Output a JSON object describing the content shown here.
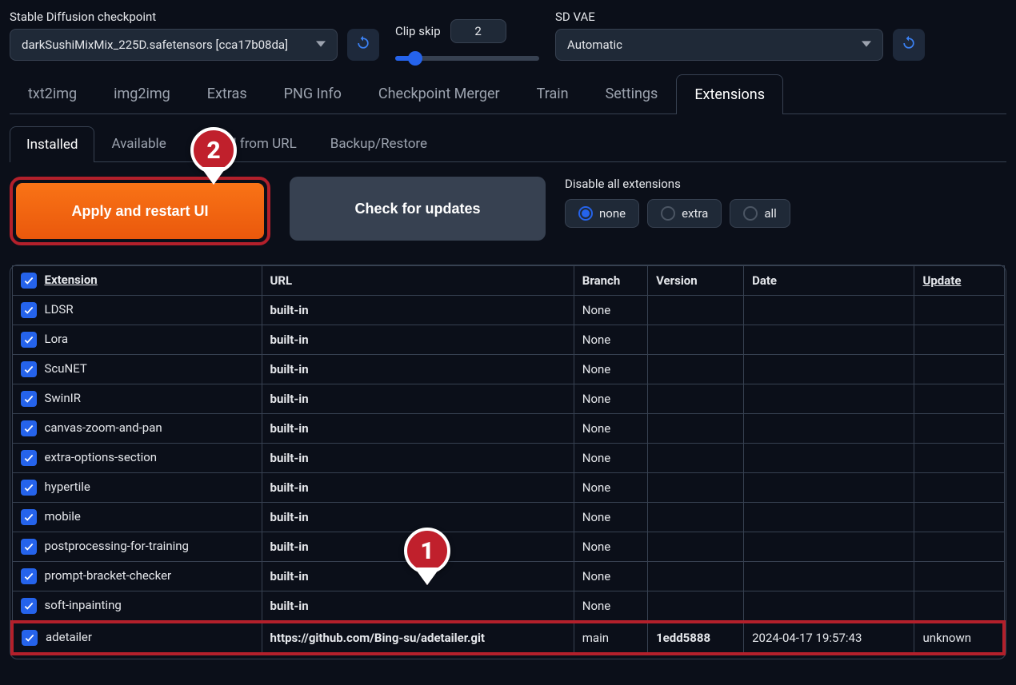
{
  "header": {
    "checkpoint_label": "Stable Diffusion checkpoint",
    "checkpoint_value": "darkSushiMixMix_225D.safetensors [cca17b08da]",
    "clip_skip_label": "Clip skip",
    "clip_skip_value": "2",
    "vae_label": "SD VAE",
    "vae_value": "Automatic"
  },
  "main_tabs": [
    "txt2img",
    "img2img",
    "Extras",
    "PNG Info",
    "Checkpoint Merger",
    "Train",
    "Settings",
    "Extensions"
  ],
  "main_tab_active": 7,
  "sub_tabs": [
    "Installed",
    "Available",
    "Install from URL",
    "Backup/Restore"
  ],
  "sub_tab_active": 0,
  "buttons": {
    "apply": "Apply and restart UI",
    "check": "Check for updates"
  },
  "disable": {
    "label": "Disable all extensions",
    "options": [
      "none",
      "extra",
      "all"
    ],
    "selected": 0
  },
  "table": {
    "headers": [
      "Extension",
      "URL",
      "Branch",
      "Version",
      "Date",
      "Update"
    ],
    "rows": [
      {
        "name": "LDSR",
        "url": "built-in",
        "branch": "None",
        "version": "",
        "date": "",
        "update": ""
      },
      {
        "name": "Lora",
        "url": "built-in",
        "branch": "None",
        "version": "",
        "date": "",
        "update": ""
      },
      {
        "name": "ScuNET",
        "url": "built-in",
        "branch": "None",
        "version": "",
        "date": "",
        "update": ""
      },
      {
        "name": "SwinIR",
        "url": "built-in",
        "branch": "None",
        "version": "",
        "date": "",
        "update": ""
      },
      {
        "name": "canvas-zoom-and-pan",
        "url": "built-in",
        "branch": "None",
        "version": "",
        "date": "",
        "update": ""
      },
      {
        "name": "extra-options-section",
        "url": "built-in",
        "branch": "None",
        "version": "",
        "date": "",
        "update": ""
      },
      {
        "name": "hypertile",
        "url": "built-in",
        "branch": "None",
        "version": "",
        "date": "",
        "update": ""
      },
      {
        "name": "mobile",
        "url": "built-in",
        "branch": "None",
        "version": "",
        "date": "",
        "update": ""
      },
      {
        "name": "postprocessing-for-training",
        "url": "built-in",
        "branch": "None",
        "version": "",
        "date": "",
        "update": ""
      },
      {
        "name": "prompt-bracket-checker",
        "url": "built-in",
        "branch": "None",
        "version": "",
        "date": "",
        "update": ""
      },
      {
        "name": "soft-inpainting",
        "url": "built-in",
        "branch": "None",
        "version": "",
        "date": "",
        "update": ""
      },
      {
        "name": "adetailer",
        "url": "https://github.com/Bing-su/adetailer.git",
        "branch": "main",
        "version": "1edd5888",
        "date": "2024-04-17 19:57:43",
        "update": "unknown",
        "highlight": true
      }
    ]
  },
  "markers": {
    "one": "1",
    "two": "2"
  }
}
